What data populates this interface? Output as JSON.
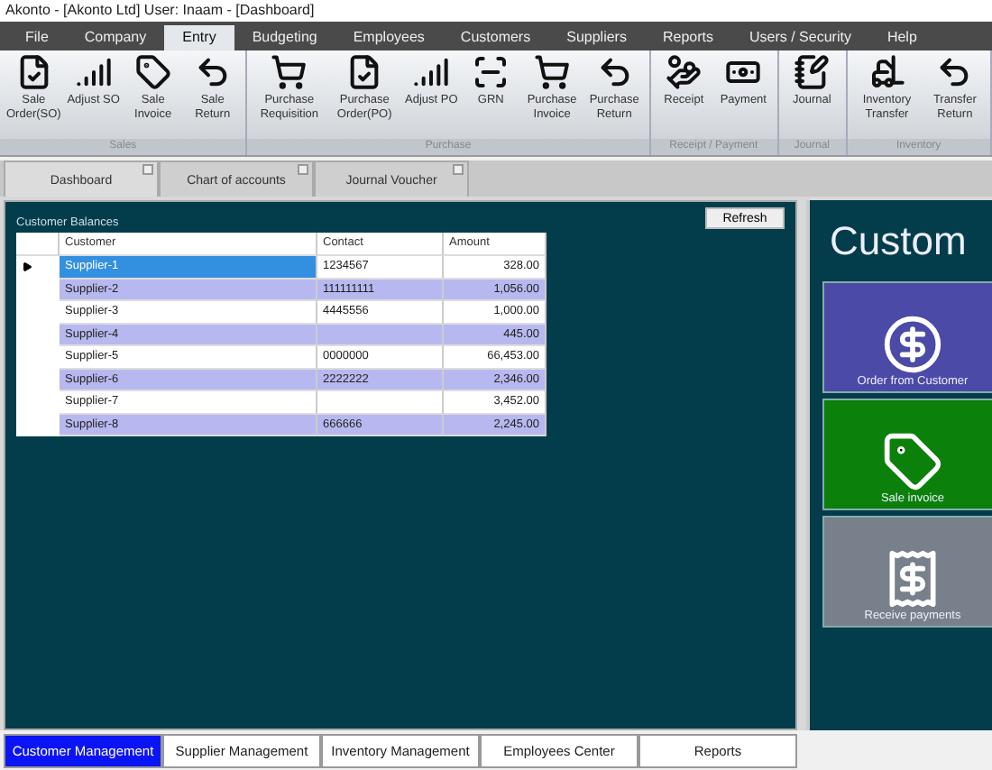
{
  "window": {
    "title": "Akonto - [Akonto Ltd]  User: Inaam - [Dashboard]"
  },
  "menu": [
    {
      "label": "File",
      "selected": false
    },
    {
      "label": "Company",
      "selected": false
    },
    {
      "label": "Entry",
      "selected": true
    },
    {
      "label": "Budgeting",
      "selected": false
    },
    {
      "label": "Employees",
      "selected": false
    },
    {
      "label": "Customers",
      "selected": false
    },
    {
      "label": "Suppliers",
      "selected": false
    },
    {
      "label": "Reports",
      "selected": false
    },
    {
      "label": "Users / Security",
      "selected": false
    },
    {
      "label": "Help",
      "selected": false
    }
  ],
  "ribbon": [
    {
      "group": "Sales",
      "buttons": [
        {
          "kind": "order",
          "label": "Sale Order(SO)"
        },
        {
          "kind": "adjust",
          "label": "Adjust SO"
        },
        {
          "kind": "tag",
          "label": "Sale Invoice"
        },
        {
          "kind": "return",
          "label": "Sale Return"
        }
      ]
    },
    {
      "group": "Purchase",
      "buttons": [
        {
          "kind": "cart",
          "label": "Purchase Requisition"
        },
        {
          "kind": "order",
          "label": "Purchase Order(PO)"
        },
        {
          "kind": "adjust",
          "label": "Adjust PO"
        },
        {
          "kind": "grn",
          "label": "GRN"
        },
        {
          "kind": "cart",
          "label": "Purchase Invoice"
        },
        {
          "kind": "return",
          "label": "Purchase Return"
        }
      ]
    },
    {
      "group": "Receipt / Payment",
      "buttons": [
        {
          "kind": "receipt",
          "label": "Receipt"
        },
        {
          "kind": "payment",
          "label": "Payment"
        }
      ]
    },
    {
      "group": "Journal",
      "buttons": [
        {
          "kind": "journal",
          "label": "Journal"
        }
      ]
    },
    {
      "group": "Inventory",
      "buttons": [
        {
          "kind": "transfer",
          "label": "Inventory Transfer"
        },
        {
          "kind": "return",
          "label": "Transfer Return"
        }
      ]
    }
  ],
  "doc_tabs": [
    {
      "label": "Dashboard",
      "selected": true
    },
    {
      "label": "Chart of accounts",
      "selected": false
    },
    {
      "label": "Journal Voucher",
      "selected": false
    }
  ],
  "balances": {
    "title": "Customer Balances",
    "refresh": "Refresh",
    "columns": [
      "Customer",
      "Contact",
      "Amount"
    ],
    "rows": [
      {
        "customer": "Supplier-1",
        "contact": "1234567",
        "amount": "328.00",
        "selected": true
      },
      {
        "customer": "Supplier-2",
        "contact": "111111111",
        "amount": "1,056.00",
        "selected": false
      },
      {
        "customer": "Supplier-3",
        "contact": "4445556",
        "amount": "1,000.00",
        "selected": false
      },
      {
        "customer": "Supplier-4",
        "contact": "",
        "amount": "445.00",
        "selected": false
      },
      {
        "customer": "Supplier-5",
        "contact": "0000000",
        "amount": "66,453.00",
        "selected": false
      },
      {
        "customer": "Supplier-6",
        "contact": "2222222",
        "amount": "2,346.00",
        "selected": false
      },
      {
        "customer": "Supplier-7",
        "contact": "",
        "amount": "3,452.00",
        "selected": false
      },
      {
        "customer": "Supplier-8",
        "contact": "666666",
        "amount": "2,245.00",
        "selected": false
      }
    ]
  },
  "side": {
    "heading": "Custom",
    "cards": [
      {
        "kind": "order",
        "label": "Order from Customer",
        "color": "#4b4aa6"
      },
      {
        "kind": "sale",
        "label": "Sale invoice",
        "color": "#0b800b"
      },
      {
        "kind": "payment",
        "label": "Receive payments",
        "color": "#77808b"
      }
    ]
  },
  "bottom_tabs": [
    {
      "label": "Customer Management",
      "selected": true
    },
    {
      "label": "Supplier Management",
      "selected": false
    },
    {
      "label": "Inventory Management",
      "selected": false
    },
    {
      "label": "Employees Center",
      "selected": false
    },
    {
      "label": "Reports",
      "selected": false
    }
  ]
}
